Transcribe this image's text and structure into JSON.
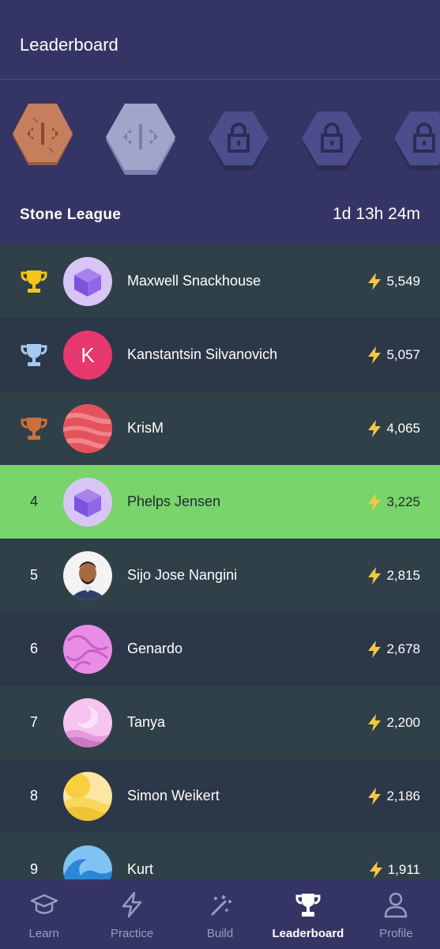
{
  "header": {
    "title": "Leaderboard"
  },
  "league": {
    "name": "Stone League",
    "timer": "1d 13h 24m",
    "badges": [
      {
        "icon": "copper-code-badge-icon",
        "state": "earned",
        "color": "#c57f5c"
      },
      {
        "icon": "stone-code-badge-icon",
        "state": "current",
        "color": "#a3a4c9"
      },
      {
        "icon": "lock-icon",
        "state": "locked",
        "color": "#4b4d8c"
      },
      {
        "icon": "lock-icon",
        "state": "locked",
        "color": "#4b4d8c"
      },
      {
        "icon": "lock-icon",
        "state": "locked",
        "color": "#4b4d8c"
      }
    ]
  },
  "rows": [
    {
      "rank": "",
      "trophy": "gold-trophy-icon",
      "name": "Maxwell Snackhouse",
      "score": "5,549",
      "avatar": "purple-cube-avatar"
    },
    {
      "rank": "",
      "trophy": "silver-trophy-icon",
      "name": "Kanstantsin Silvanovich",
      "score": "5,057",
      "avatar": "letter-avatar",
      "avatar_letter": "K"
    },
    {
      "rank": "",
      "trophy": "bronze-trophy-icon",
      "name": "KrisM",
      "score": "4,065",
      "avatar": "red-planet-avatar"
    },
    {
      "rank": "4",
      "name": "Phelps Jensen",
      "score": "3,225",
      "avatar": "purple-cube-avatar",
      "highlighted": true
    },
    {
      "rank": "5",
      "name": "Sijo Jose Nangini",
      "score": "2,815",
      "avatar": "photo-avatar"
    },
    {
      "rank": "6",
      "name": "Genardo",
      "score": "2,678",
      "avatar": "pink-swirl-avatar"
    },
    {
      "rank": "7",
      "name": "Tanya",
      "score": "2,200",
      "avatar": "pink-moon-avatar"
    },
    {
      "rank": "8",
      "name": "Simon Weikert",
      "score": "2,186",
      "avatar": "yellow-sun-avatar"
    },
    {
      "rank": "9",
      "name": "Kurt",
      "score": "1,911",
      "avatar": "blue-wave-avatar"
    }
  ],
  "nav": [
    {
      "label": "Learn",
      "icon": "graduation-cap-icon"
    },
    {
      "label": "Practice",
      "icon": "lightning-icon"
    },
    {
      "label": "Build",
      "icon": "magic-wand-icon"
    },
    {
      "label": "Leaderboard",
      "icon": "trophy-icon",
      "active": true
    },
    {
      "label": "Profile",
      "icon": "person-icon"
    }
  ],
  "colors": {
    "header_bg": "#353565",
    "row_odd": "#2f4048",
    "row_even": "#2c3748",
    "highlight": "#78d46b",
    "gold": "#f5c518",
    "silver": "#a9c9ef",
    "bronze": "#c9703d",
    "bolt": "#f5c842"
  }
}
